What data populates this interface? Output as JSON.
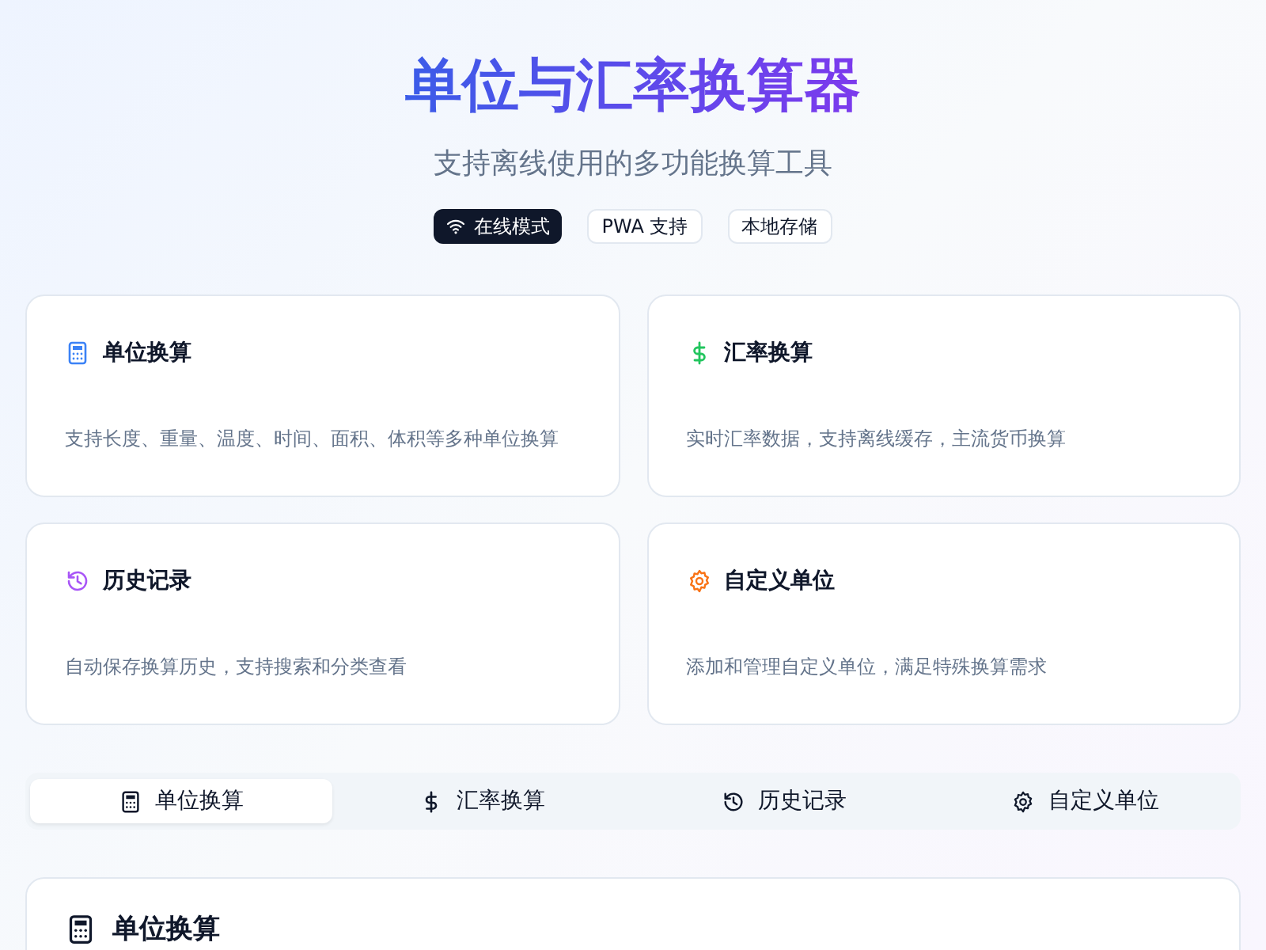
{
  "header": {
    "title": "单位与汇率换算器",
    "subtitle": "支持离线使用的多功能换算工具"
  },
  "badges": [
    {
      "label": "在线模式",
      "kind": "status"
    },
    {
      "label": "PWA 支持",
      "kind": "tag"
    },
    {
      "label": "本地存储",
      "kind": "tag"
    }
  ],
  "features": [
    {
      "kind": "calculator",
      "color": "#3b82f6",
      "title": "单位换算",
      "description": "支持长度、重量、温度、时间、面积、体积等多种单位换算"
    },
    {
      "kind": "dollar",
      "color": "#22c55e",
      "title": "汇率换算",
      "description": "实时汇率数据，支持离线缓存，主流货币换算"
    },
    {
      "kind": "history",
      "color": "#a855f7",
      "title": "历史记录",
      "description": "自动保存换算历史，支持搜索和分类查看"
    },
    {
      "kind": "gear",
      "color": "#f97316",
      "title": "自定义单位",
      "description": "添加和管理自定义单位，满足特殊换算需求"
    }
  ],
  "tabs": [
    {
      "label": "单位换算",
      "kind": "calculator",
      "selected": true
    },
    {
      "label": "汇率换算",
      "kind": "dollar",
      "selected": false
    },
    {
      "label": "历史记录",
      "kind": "history",
      "selected": false
    },
    {
      "label": "自定义单位",
      "kind": "gear",
      "selected": false
    }
  ],
  "panel": {
    "title": "单位换算"
  }
}
